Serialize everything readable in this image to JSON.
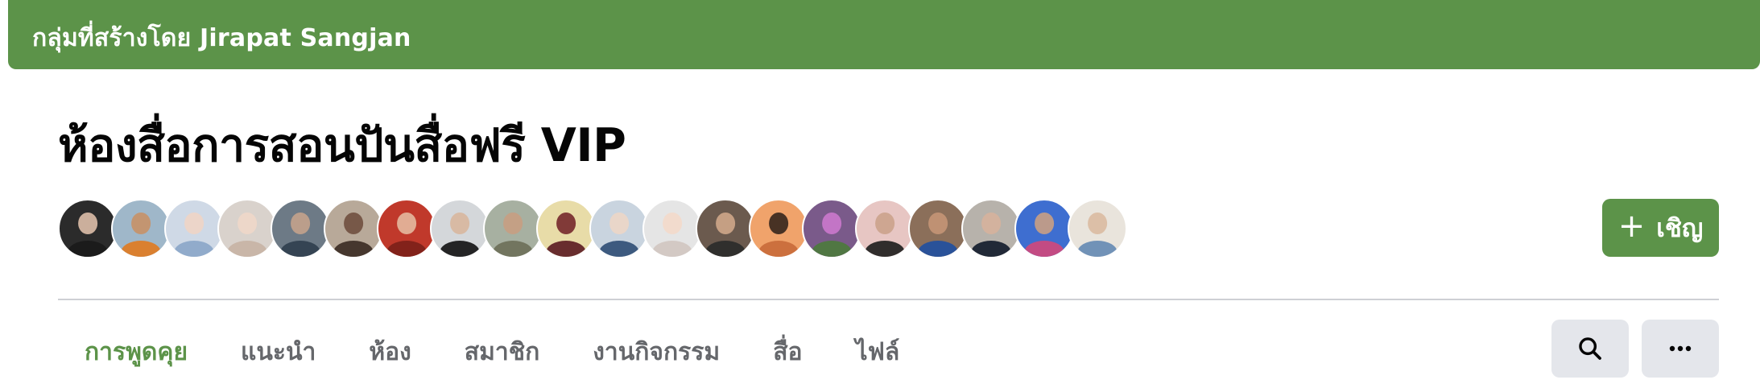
{
  "banner": {
    "text": "กลุ่มที่สร้างโดย Jirapat Sangjan",
    "color": "#5c9349"
  },
  "group": {
    "title": "ห้องสื่อการสอนปันสื่อฟรี VIP"
  },
  "members": {
    "avatars": [
      {
        "bg": "#2b2b2b",
        "face": "#e8c7b0",
        "body": "#1a1a1a"
      },
      {
        "bg": "#9fb7c9",
        "face": "#c98f62",
        "body": "#e07a1f"
      },
      {
        "bg": "#cfd9e6",
        "face": "#f1d4c3",
        "body": "#8aa5c8"
      },
      {
        "bg": "#d9d2cc",
        "face": "#f0d8c8",
        "body": "#c6b3a4"
      },
      {
        "bg": "#6d7a86",
        "face": "#c9a58c",
        "body": "#2f3e4e"
      },
      {
        "bg": "#b8a999",
        "face": "#6b4a3a",
        "body": "#3a2a22"
      },
      {
        "bg": "#c0392b",
        "face": "#e6c1a6",
        "body": "#7b2018"
      },
      {
        "bg": "#d4d7da",
        "face": "#d8b59a",
        "body": "#111111"
      },
      {
        "bg": "#a7b0a1",
        "face": "#c99e80",
        "body": "#6d6f58"
      },
      {
        "bg": "#e8dca8",
        "face": "#6e1d24",
        "body": "#5a1a20"
      },
      {
        "bg": "#c9d4df",
        "face": "#efd6c6",
        "body": "#2e4d74"
      },
      {
        "bg": "#e5e5e5",
        "face": "#f4d9c9",
        "body": "#d0c5c0"
      },
      {
        "bg": "#6b5a4e",
        "face": "#d5ab8d",
        "body": "#2a2a2a"
      },
      {
        "bg": "#f0a36b",
        "face": "#2a1e18",
        "body": "#c86a3a"
      },
      {
        "bg": "#7a5a8a",
        "face": "#d07ad0",
        "body": "#4b7a3b"
      },
      {
        "bg": "#e7c6c3",
        "face": "#c9a088",
        "body": "#1c1c1c"
      },
      {
        "bg": "#8b6f5a",
        "face": "#c89878",
        "body": "#1f4fa0"
      },
      {
        "bg": "#b7b2ab",
        "face": "#d8b29b",
        "body": "#111a2a"
      },
      {
        "bg": "#3e6ed0",
        "face": "#d1a27f",
        "body": "#d1477a"
      },
      {
        "bg": "#e9e4dc",
        "face": "#d9b89d",
        "body": "#6488b3"
      }
    ]
  },
  "invite": {
    "label": "เชิญ",
    "icon": "plus-icon"
  },
  "tabs": [
    {
      "label": "การพูดคุย",
      "active": true
    },
    {
      "label": "แนะนำ",
      "active": false
    },
    {
      "label": "ห้อง",
      "active": false
    },
    {
      "label": "สมาชิก",
      "active": false
    },
    {
      "label": "งานกิจกรรม",
      "active": false
    },
    {
      "label": "สื่อ",
      "active": false
    },
    {
      "label": "ไฟล์",
      "active": false
    }
  ],
  "actions": {
    "search_icon": "search-icon",
    "more_icon": "more-horizontal-icon"
  }
}
